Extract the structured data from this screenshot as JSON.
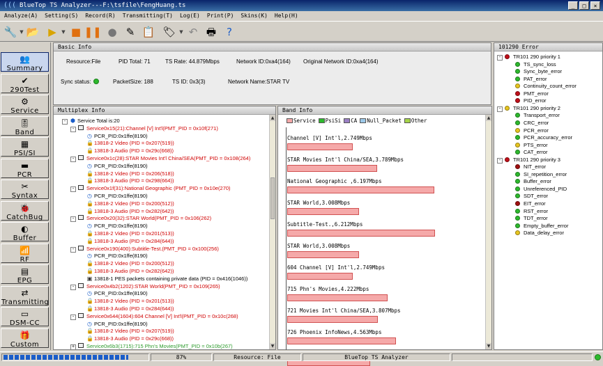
{
  "window": {
    "title": "BlueTop TS Analyzer---F:\\tsfile\\FengHuang.ts"
  },
  "menu": [
    "Analyze(A)",
    "Setting(S)",
    "Record(R)",
    "Transmitting(T)",
    "Log(E)",
    "Print(P)",
    "Skins(K)",
    "Help(H)"
  ],
  "nav": [
    "Summary",
    "290Test",
    "Service",
    "Band",
    "PSI/SI",
    "PCR",
    "Syntax",
    "CatchBug",
    "Buffer",
    "RF",
    "EPG",
    "Transmitting",
    "DSM-CC",
    "Custom"
  ],
  "basic": {
    "title": "Basic Info",
    "resource": "Resource:File",
    "pid_total": "PID Total: 71",
    "ts_rate": "TS  Rate: 44.879Mbps",
    "network_id": "Network ID:0xa4(164)",
    "orig_network_id": "Original Network ID:0xa4(164)",
    "sync_status": "Sync status:",
    "packet_size": "PacketSize: 188",
    "ts_id": "TS ID: 0x3(3)",
    "network_name": "Network Name:STAR TV"
  },
  "mux": {
    "title": "Multiplex Info",
    "rows": [
      {
        "indent": 0,
        "twisty": "-",
        "icon": "cube",
        "text": "Service Total is:20",
        "color": "blk"
      },
      {
        "indent": 1,
        "twisty": "-",
        "icon": "doc",
        "text": "Service0x15(21):Channel [V] Int'l(PMT_PID = 0x10f(271)",
        "color": "red"
      },
      {
        "indent": 2,
        "icon": "clock",
        "text": "PCR_PID:0x1ffe(8190)",
        "color": "blk"
      },
      {
        "indent": 2,
        "icon": "lock",
        "text": "13818-2 Video (PID = 0x207(519))",
        "color": "red"
      },
      {
        "indent": 2,
        "icon": "lock",
        "text": "13818-3 Audio (PID = 0x29c(668))",
        "color": "red"
      },
      {
        "indent": 1,
        "twisty": "-",
        "icon": "doc",
        "text": "Service0x1c(28):STAR Movies Int'l China/SEA(PMT_PID = 0x108(264)",
        "color": "red"
      },
      {
        "indent": 2,
        "icon": "clock",
        "text": "PCR_PID:0x1ffe(8190)",
        "color": "blk"
      },
      {
        "indent": 2,
        "icon": "lock",
        "text": "13818-2 Video (PID = 0x206(518))",
        "color": "red"
      },
      {
        "indent": 2,
        "icon": "lock",
        "text": "13818-3 Audio (PID = 0x298(664))",
        "color": "red"
      },
      {
        "indent": 1,
        "twisty": "-",
        "icon": "doc",
        "text": "Service0x1f(31):National Geographic (PMT_PID = 0x10e(270)",
        "color": "red"
      },
      {
        "indent": 2,
        "icon": "clock",
        "text": "PCR_PID:0x1ffe(8190)",
        "color": "blk"
      },
      {
        "indent": 2,
        "icon": "lock",
        "text": "13818-2 Video (PID = 0x200(512))",
        "color": "red"
      },
      {
        "indent": 2,
        "icon": "lock",
        "text": "13818-3 Audio (PID = 0x282(642))",
        "color": "red"
      },
      {
        "indent": 1,
        "twisty": "-",
        "icon": "doc",
        "text": "Service0x20(32):STAR World(PMT_PID = 0x106(262)",
        "color": "red"
      },
      {
        "indent": 2,
        "icon": "clock",
        "text": "PCR_PID:0x1ffe(8190)",
        "color": "blk"
      },
      {
        "indent": 2,
        "icon": "lock",
        "text": "13818-2 Video (PID = 0x201(513))",
        "color": "red"
      },
      {
        "indent": 2,
        "icon": "lock",
        "text": "13818-3 Audio (PID = 0x284(644))",
        "color": "red"
      },
      {
        "indent": 1,
        "twisty": "-",
        "icon": "doc",
        "text": "Service0x190(400):Subtitle-Test.(PMT_PID = 0x100(256)",
        "color": "red"
      },
      {
        "indent": 2,
        "icon": "clock",
        "text": "PCR_PID:0x1ffe(8190)",
        "color": "blk"
      },
      {
        "indent": 2,
        "icon": "lock",
        "text": "13818-2 Video (PID = 0x200(512))",
        "color": "red"
      },
      {
        "indent": 2,
        "icon": "lock",
        "text": "13818-3 Audio (PID = 0x282(642))",
        "color": "red"
      },
      {
        "indent": 2,
        "icon": "pes",
        "text": "13818-1 PES packets containing private data (PID = 0x416(1046))",
        "color": "blk"
      },
      {
        "indent": 1,
        "twisty": "-",
        "icon": "doc",
        "text": "Service0x4b2(1202):STAR World(PMT_PID = 0x109(265)",
        "color": "red"
      },
      {
        "indent": 2,
        "icon": "clock",
        "text": "PCR_PID:0x1ffe(8190)",
        "color": "blk"
      },
      {
        "indent": 2,
        "icon": "lock",
        "text": "13818-2 Video (PID = 0x201(513))",
        "color": "red"
      },
      {
        "indent": 2,
        "icon": "lock",
        "text": "13818-3 Audio (PID = 0x284(644))",
        "color": "red"
      },
      {
        "indent": 1,
        "twisty": "-",
        "icon": "doc",
        "text": "Service0x644(1604):604 Channel [V] Int'l(PMT_PID = 0x10c(268)",
        "color": "red"
      },
      {
        "indent": 2,
        "icon": "clock",
        "text": "PCR_PID:0x1ffe(8190)",
        "color": "blk"
      },
      {
        "indent": 2,
        "icon": "lock",
        "text": "13818-2 Video (PID = 0x207(519))",
        "color": "red"
      },
      {
        "indent": 2,
        "icon": "lock",
        "text": "13818-3 Audio (PID = 0x29c(668))",
        "color": "red"
      },
      {
        "indent": 1,
        "twisty": "+",
        "icon": "doc",
        "text": "Service0x6b3(1715):715 Phn's Movies(PMT_PID = 0x10b(267)",
        "color": "grn"
      }
    ]
  },
  "band": {
    "title": "Band Info",
    "legend": [
      {
        "label": "Service",
        "color": "#f5a9a9"
      },
      {
        "label": "PsiSi",
        "color": "#2db92d"
      },
      {
        "label": "CA",
        "color": "#9a7fc4"
      },
      {
        "label": "Null_Packet",
        "color": "#9cc8e8"
      },
      {
        "label": "Other",
        "color": "#a6d44a"
      }
    ],
    "bars": [
      {
        "label": "Channel [V] Int'l,2.749Mbps",
        "mbps": 2.749
      },
      {
        "label": "STAR Movies Int'l China/SEA,3.789Mbps",
        "mbps": 3.789
      },
      {
        "label": "National Geographic ,6.197Mbps",
        "mbps": 6.197
      },
      {
        "label": "STAR World,3.008Mbps",
        "mbps": 3.008
      },
      {
        "label": "Subtitle-Test.,6.212Mbps",
        "mbps": 6.212
      },
      {
        "label": "STAR World,3.008Mbps",
        "mbps": 3.008
      },
      {
        "label": "604 Channel [V] Int'l,2.749Mbps",
        "mbps": 2.749
      },
      {
        "label": "715 Phn's Movies,4.222Mbps",
        "mbps": 4.222
      },
      {
        "label": "721 Movies Int'l China/SEA,3.807Mbps",
        "mbps": 3.807
      },
      {
        "label": "726 Phoenix InfoNews,4.563Mbps",
        "mbps": 4.563
      },
      {
        "label": "",
        "mbps": 3.5
      }
    ]
  },
  "errors": {
    "title": "101290 Error",
    "groups": [
      {
        "label": "TR101 290 priority 1",
        "status": "red",
        "items": [
          {
            "label": "TS_sync_loss",
            "status": "green"
          },
          {
            "label": "Sync_byte_error",
            "status": "green"
          },
          {
            "label": "PAT_error",
            "status": "green"
          },
          {
            "label": "Continuity_count_error",
            "status": "yellow"
          },
          {
            "label": "PMT_error",
            "status": "red"
          },
          {
            "label": "PID_error",
            "status": "red"
          }
        ]
      },
      {
        "label": "TR101 290 priority 2",
        "status": "yellow",
        "items": [
          {
            "label": "Transport_error",
            "status": "green"
          },
          {
            "label": "CRC_error",
            "status": "green"
          },
          {
            "label": "PCR_error",
            "status": "yellow"
          },
          {
            "label": "PCR_accuracy_error",
            "status": "green"
          },
          {
            "label": "PTS_error",
            "status": "yellow"
          },
          {
            "label": "CAT_error",
            "status": "green"
          }
        ]
      },
      {
        "label": "TR101 290 priority 3",
        "status": "red",
        "items": [
          {
            "label": "NIT_error",
            "status": "dred"
          },
          {
            "label": "SI_repetition_error",
            "status": "green"
          },
          {
            "label": "Buffer_error",
            "status": "green"
          },
          {
            "label": "Unreferenced_PID",
            "status": "green"
          },
          {
            "label": "SDT_error",
            "status": "green"
          },
          {
            "label": "EIT_error",
            "status": "dred"
          },
          {
            "label": "RST_error",
            "status": "green"
          },
          {
            "label": "TDT_error",
            "status": "green"
          },
          {
            "label": "Empty_buffer_error",
            "status": "green"
          },
          {
            "label": "Data_delay_error",
            "status": "yellow"
          }
        ]
      }
    ]
  },
  "status": {
    "progress_pct": 87,
    "progress_text": "87%",
    "resource": "Resource: File",
    "app": "BlueTop TS Analyzer"
  }
}
